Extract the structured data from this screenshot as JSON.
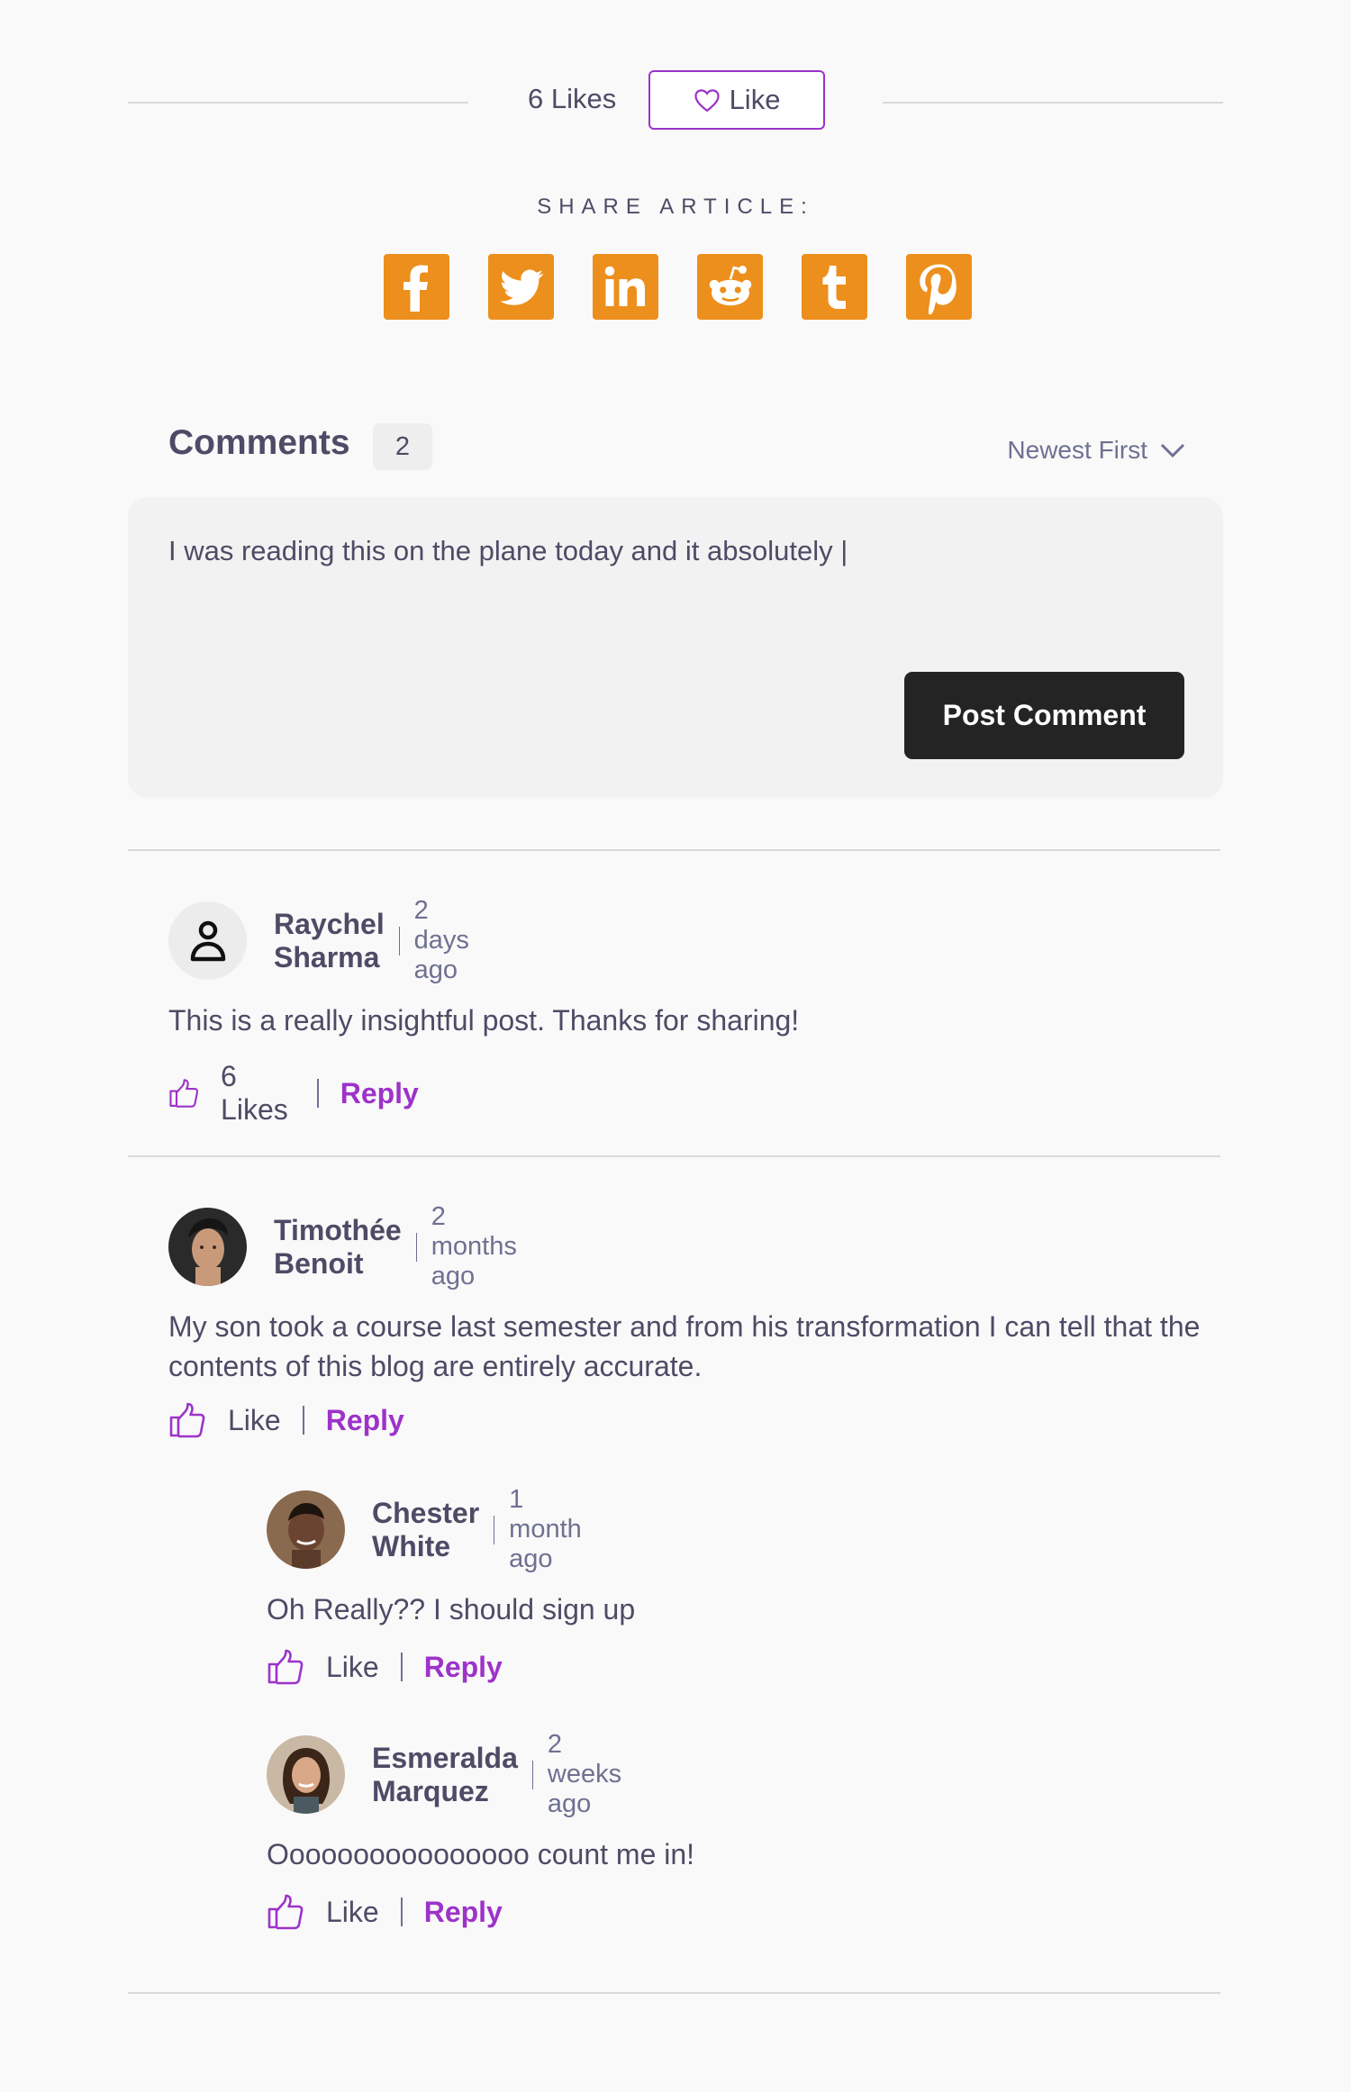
{
  "article": {
    "likes_count": "6 Likes",
    "like_button_label": "Like",
    "share_title": "SHARE ARTICLE:",
    "share_icons": [
      "facebook-icon",
      "twitter-icon",
      "linkedin-icon",
      "reddit-icon",
      "tumblr-icon",
      "pinterest-icon"
    ],
    "share_color": "#ed8f1c"
  },
  "comments_section": {
    "title": "Comments",
    "count": "2",
    "sort_label": "Newest First",
    "input_value": "I was reading this on the plane today and it absolutely |",
    "post_button_label": "Post Comment"
  },
  "comments": [
    {
      "name": "Raychel Sharma",
      "time": "2 days ago",
      "text": "This is a really insightful post. Thanks for sharing!",
      "likes": "6 Likes",
      "reply": "Reply"
    },
    {
      "name": "Timothée Benoit",
      "time": "2 months ago",
      "text": "My son took a course last semester and from his transformation I can tell that the contents of this blog are entirely accurate.",
      "likes": "Like",
      "reply": "Reply"
    }
  ],
  "replies": [
    {
      "name": "Chester White",
      "time": "1 month ago",
      "text": "Oh Really?? I should sign up",
      "likes": "Like",
      "reply": "Reply"
    },
    {
      "name": "Esmeralda Marquez",
      "time": "2 weeks ago",
      "text": "Oooooooooooooooo count me in!",
      "likes": "Like",
      "reply": "Reply"
    }
  ],
  "colors": {
    "accent": "#9d33c9",
    "text": "#4e4b66",
    "button_dark": "#242424"
  }
}
